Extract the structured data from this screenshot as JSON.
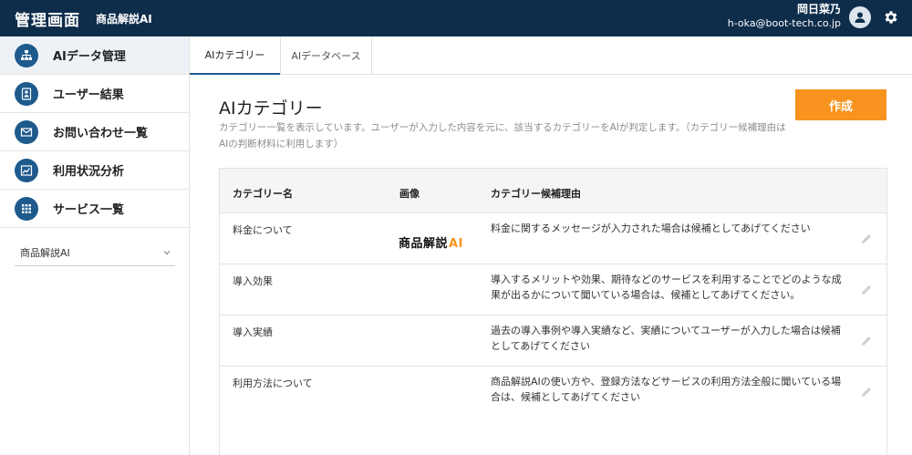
{
  "header": {
    "title": "管理画面",
    "product": "商品解説AI",
    "user_name": "岡日菜乃",
    "user_email": "h-oka@boot-tech.co.jp",
    "colors": {
      "header_bg": "#0e2d4b",
      "accent": "#f7931e",
      "primary": "#1e5a8c"
    }
  },
  "sidebar": {
    "items": [
      {
        "label": "AIデータ管理",
        "icon": "sitemap-icon"
      },
      {
        "label": "ユーザー結果",
        "icon": "user-badge-icon"
      },
      {
        "label": "お問い合わせ一覧",
        "icon": "mail-icon"
      },
      {
        "label": "利用状況分析",
        "icon": "chart-icon"
      },
      {
        "label": "サービス一覧",
        "icon": "grid-icon"
      }
    ],
    "group": {
      "label": "商品解説AI",
      "icon": "chevron-down-icon"
    }
  },
  "tabs": [
    {
      "label": "AIカテゴリー",
      "active": true
    },
    {
      "label": "AIデータベース",
      "active": false
    }
  ],
  "main": {
    "title": "AIカテゴリー",
    "description": "カテゴリー一覧を表示しています。ユーザーが入力した内容を元に、該当するカテゴリーをAIが判定します。（カテゴリー候補理由はAIの判断材料に利用します）",
    "create_label": "作成"
  },
  "table": {
    "headers": [
      "カテゴリー名",
      "画像",
      "カテゴリー候補理由"
    ],
    "rows": [
      {
        "name": "料金について",
        "image_text": "商品解説",
        "image_ai": "AI",
        "reason": "料金に関するメッセージが入力された場合は候補としてあげてください"
      },
      {
        "name": "導入効果",
        "image_text": "",
        "image_ai": "",
        "reason": "導入するメリットや効果、期待などのサービスを利用することでどのような成果が出るかについて聞いている場合は、候補としてあげてください。"
      },
      {
        "name": "導入実績",
        "image_text": "",
        "image_ai": "",
        "reason": "過去の導入事例や導入実績など、実績についてユーザーが入力した場合は候補としてあげてください"
      },
      {
        "name": "利用方法について",
        "image_text": "",
        "image_ai": "",
        "reason": "商品解説AIの使い方や、登録方法などサービスの利用方法全般に聞いている場合は、候補としてあげてください"
      }
    ]
  }
}
